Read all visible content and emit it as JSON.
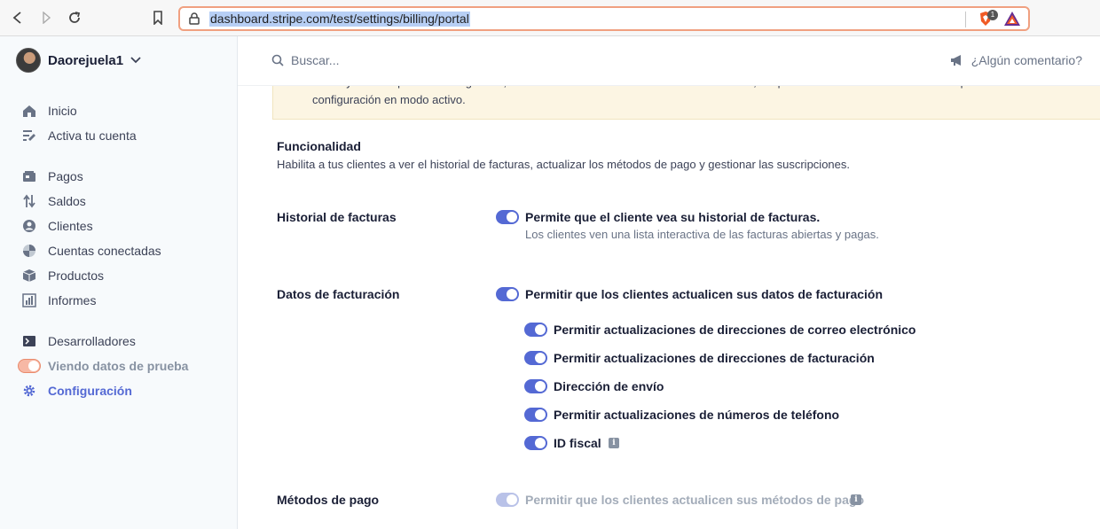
{
  "browser": {
    "url": "dashboard.stripe.com/test/settings/billing/portal",
    "shield_count": "1"
  },
  "sidebar": {
    "account_name": "Daorejuela1",
    "items": [
      {
        "label": "Inicio",
        "icon": "home-icon"
      },
      {
        "label": "Activa tu cuenta",
        "icon": "activate-icon"
      },
      {
        "label": "Pagos",
        "icon": "payments-icon"
      },
      {
        "label": "Saldos",
        "icon": "balances-icon"
      },
      {
        "label": "Clientes",
        "icon": "customers-icon"
      },
      {
        "label": "Cuentas conectadas",
        "icon": "connected-accounts-icon"
      },
      {
        "label": "Productos",
        "icon": "products-icon"
      },
      {
        "label": "Informes",
        "icon": "reports-icon"
      },
      {
        "label": "Desarrolladores",
        "icon": "terminal-icon"
      },
      {
        "label": "Viendo datos de prueba",
        "icon": "test-mode-toggle"
      },
      {
        "label": "Configuración",
        "icon": "gear-icon"
      }
    ]
  },
  "topbar": {
    "search_placeholder": "Buscar...",
    "feedback_label": "¿Algún comentario?"
  },
  "banner": {
    "line1": "Para ayudarte a probar tu integración, los cambios introducidos en las funcionalidades, los productos o la información de la empresa no afectarán a tu",
    "line2": "configuración en modo activo."
  },
  "section": {
    "title": "Funcionalidad",
    "description": "Habilita a tus clientes a ver el historial de facturas, actualizar los métodos de pago y gestionar las suscripciones."
  },
  "invoice_history": {
    "label": "Historial de facturas",
    "option": "Permite que el cliente vea su historial de facturas.",
    "sub": "Los clientes ven una lista interactiva de las facturas abiertas y pagas.",
    "enabled": true
  },
  "billing_data": {
    "label": "Datos de facturación",
    "option": "Permitir que los clientes actualicen sus datos de facturación",
    "enabled": true,
    "sub_options": [
      {
        "label": "Permitir actualizaciones de direcciones de correo electrónico",
        "enabled": true
      },
      {
        "label": "Permitir actualizaciones de direcciones de facturación",
        "enabled": true
      },
      {
        "label": "Dirección de envío",
        "enabled": true
      },
      {
        "label": "Permitir actualizaciones de números de teléfono",
        "enabled": true
      },
      {
        "label": "ID fiscal",
        "enabled": true
      }
    ]
  },
  "payment_methods": {
    "label": "Métodos de pago",
    "option": "Permitir que los clientes actualicen sus métodos de pago",
    "enabled": true,
    "disabled": true
  },
  "colors": {
    "accent": "#5469d4",
    "banner_bg": "#fcf5e3",
    "test_mode": "#f7b8a5"
  }
}
